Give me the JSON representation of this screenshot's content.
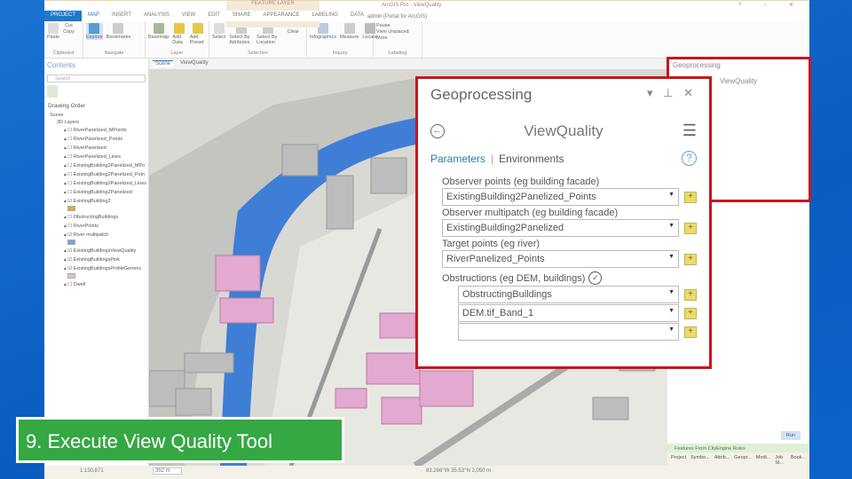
{
  "titlebar": {
    "context": "FEATURE LAYER",
    "doc": "ArcGIS Pro - ViewQuality",
    "controls": "? ▫ ✕"
  },
  "user": "admin (Portal for ArcGIS)",
  "tabs": [
    "PROJECT",
    "MAP",
    "INSERT",
    "ANALYSIS",
    "VIEW",
    "EDIT",
    "SHARE",
    "APPEARANCE",
    "LABELING",
    "DATA"
  ],
  "ribbon": {
    "groups": [
      {
        "label": "Clipboard",
        "buttons": [
          "Paste",
          "Cut",
          "Copy"
        ]
      },
      {
        "label": "Navigate",
        "buttons": [
          "Explore",
          "Bookmarks"
        ]
      },
      {
        "label": "Layer",
        "buttons": [
          "Basemap",
          "Add Data",
          "Add Preset"
        ]
      },
      {
        "label": "Selection",
        "buttons": [
          "Select",
          "Select By Attributes",
          "Select By Location",
          "Attributes",
          "Clear"
        ]
      },
      {
        "label": "Inquiry",
        "buttons": [
          "Infographics",
          "Measure",
          "Locate"
        ]
      },
      {
        "label": "Labeling",
        "buttons": [
          "Pause",
          "View Unplaced",
          "More"
        ]
      }
    ]
  },
  "contents": {
    "title": "Contents",
    "search_placeholder": "Search",
    "drawing_order": "Drawing Order",
    "scene": "Scene",
    "group": "3D Layers",
    "layers": [
      "RiverPanelized_MPoints",
      "RiverPanelized_Points",
      "RiverPanelized",
      "RiverPanelized_Lines",
      "ExistingBuilding2Panelized_MPo",
      "ExistingBuilding2Panelized_Poin",
      "ExistingBuilding2Panelized_Lines",
      "ExistingBuilding2Panelized",
      "ExistingBuilding2",
      "ObstructingBuildings",
      "RiverPoints",
      "River multipatch",
      "ExistingBuildingsViewQuality",
      "ExistingBuildingsPink",
      "ExistingBuildingsProfileGeneric",
      "Dwell"
    ]
  },
  "map_tabs": [
    "Scene",
    "ViewQuality"
  ],
  "status": {
    "scale": "1:150,871",
    "distance": "352 m",
    "coords": "83.266°W 35.53°N 2,050 m"
  },
  "geoprocessing": {
    "title": "Geoprocessing",
    "tool": "ViewQuality",
    "tab_params": "Parameters",
    "tab_env": "Environments",
    "params": [
      {
        "label": "Observer points (eg building facade)",
        "value": "ExistingBuilding2Panelized_Points"
      },
      {
        "label": "Observer multipatch (eg building facade)",
        "value": "ExistingBuilding2Panelized"
      },
      {
        "label": "Target points (eg river)",
        "value": "RiverPanelized_Points"
      }
    ],
    "obstructions_label": "Obstructions (eg DEM, buildings)",
    "obstructions": [
      "ObstructingBuildings",
      "DEM.tif_Band_1",
      ""
    ],
    "run": "Run",
    "message": "Features From CityEngine Rules",
    "bottom_tabs": [
      "Project",
      "Symbo...",
      "Attrib...",
      "Geopr...",
      "Modi...",
      "Job St...",
      "Book..."
    ]
  },
  "caption": "9. Execute View Quality Tool"
}
